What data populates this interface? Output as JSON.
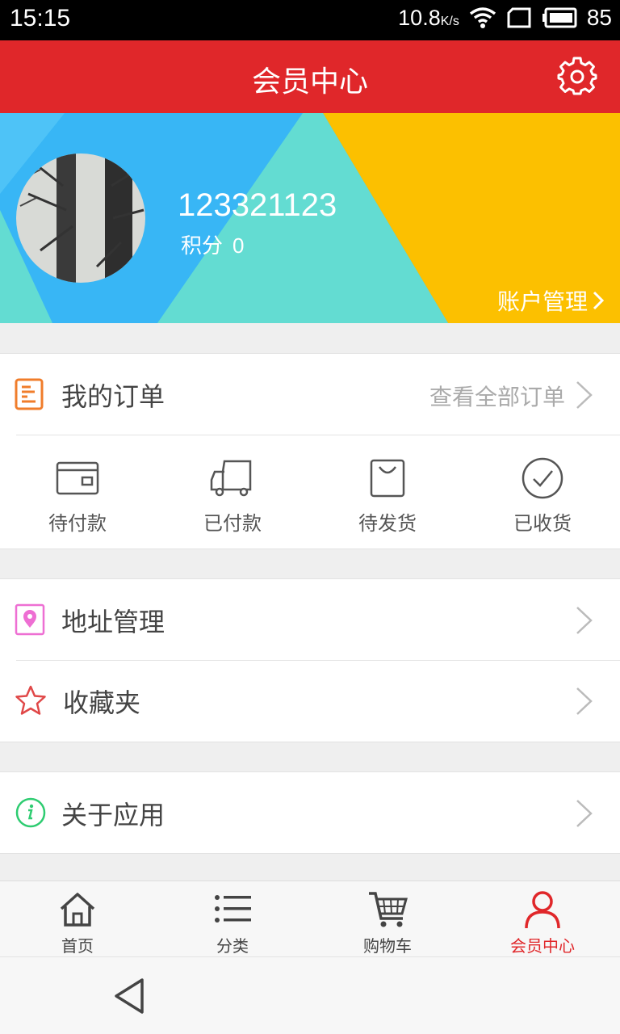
{
  "status_bar": {
    "time": "15:15",
    "speed": "10.8",
    "speed_unit": "K/s",
    "battery": "85",
    "icons": [
      "wifi-icon",
      "sim-icon",
      "battery-icon"
    ]
  },
  "header": {
    "title": "会员中心",
    "settings_icon": "gear-icon"
  },
  "profile": {
    "username": "123321123",
    "points_label": "积分",
    "points_value": "0",
    "account_link": "账户管理",
    "banner_colors": [
      "#38b6f5",
      "#63dcd2",
      "#fcc000"
    ]
  },
  "orders": {
    "title": "我的订单",
    "view_all": "查看全部订单",
    "statuses": [
      {
        "label": "待付款",
        "icon": "wallet-icon"
      },
      {
        "label": "已付款",
        "icon": "truck-icon"
      },
      {
        "label": "待发货",
        "icon": "shopping-bag-icon"
      },
      {
        "label": "已收货",
        "icon": "check-circle-icon"
      }
    ]
  },
  "menu": {
    "address": "地址管理",
    "favorites": "收藏夹",
    "about": "关于应用"
  },
  "bottom_nav": {
    "items": [
      {
        "label": "首页",
        "icon": "home-icon",
        "active": false
      },
      {
        "label": "分类",
        "icon": "list-icon",
        "active": false
      },
      {
        "label": "购物车",
        "icon": "cart-icon",
        "active": false
      },
      {
        "label": "会员中心",
        "icon": "user-icon",
        "active": true
      }
    ]
  },
  "colors": {
    "brand_red": "#e0272a",
    "orange": "#f07d2b",
    "pink": "#ee6fd3",
    "green": "#2ecc71"
  }
}
